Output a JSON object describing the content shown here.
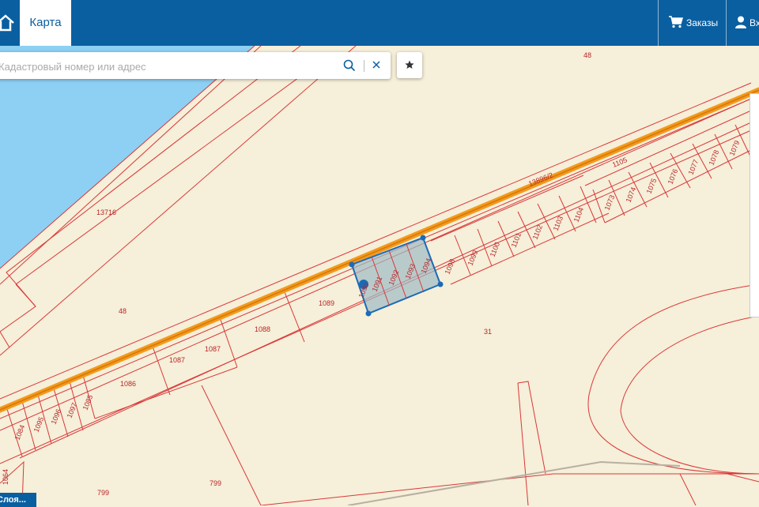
{
  "header": {
    "map_tab_label": "Карта",
    "orders_label": "Заказы",
    "login_label": "Вход"
  },
  "search": {
    "placeholder": "Кадастровый номер или адрес"
  },
  "layers_button_label": "Слоя...",
  "colors": {
    "header": "#0a5fa0",
    "land": "#f6efd9",
    "water": "#8dd0f3",
    "parcel_border": "#d9383a",
    "road": "#f39a1a",
    "selection": "#1a6bb7"
  },
  "map": {
    "parcel_labels": [
      "48",
      "13716",
      "48",
      "13896/2",
      "1105",
      "1079",
      "1078",
      "1077",
      "1076",
      "1075",
      "1074",
      "1073",
      "1104",
      "1103",
      "1102",
      "1101",
      "1100",
      "1099",
      "1098",
      "1094",
      "1093",
      "1092",
      "1091",
      "1090",
      "1089",
      "1088",
      "1087",
      "1087",
      "1086",
      "1085",
      "1097",
      "1096",
      "1095",
      "1084",
      "1064",
      "31",
      "799",
      "799"
    ],
    "selected_parcel": "1090"
  }
}
